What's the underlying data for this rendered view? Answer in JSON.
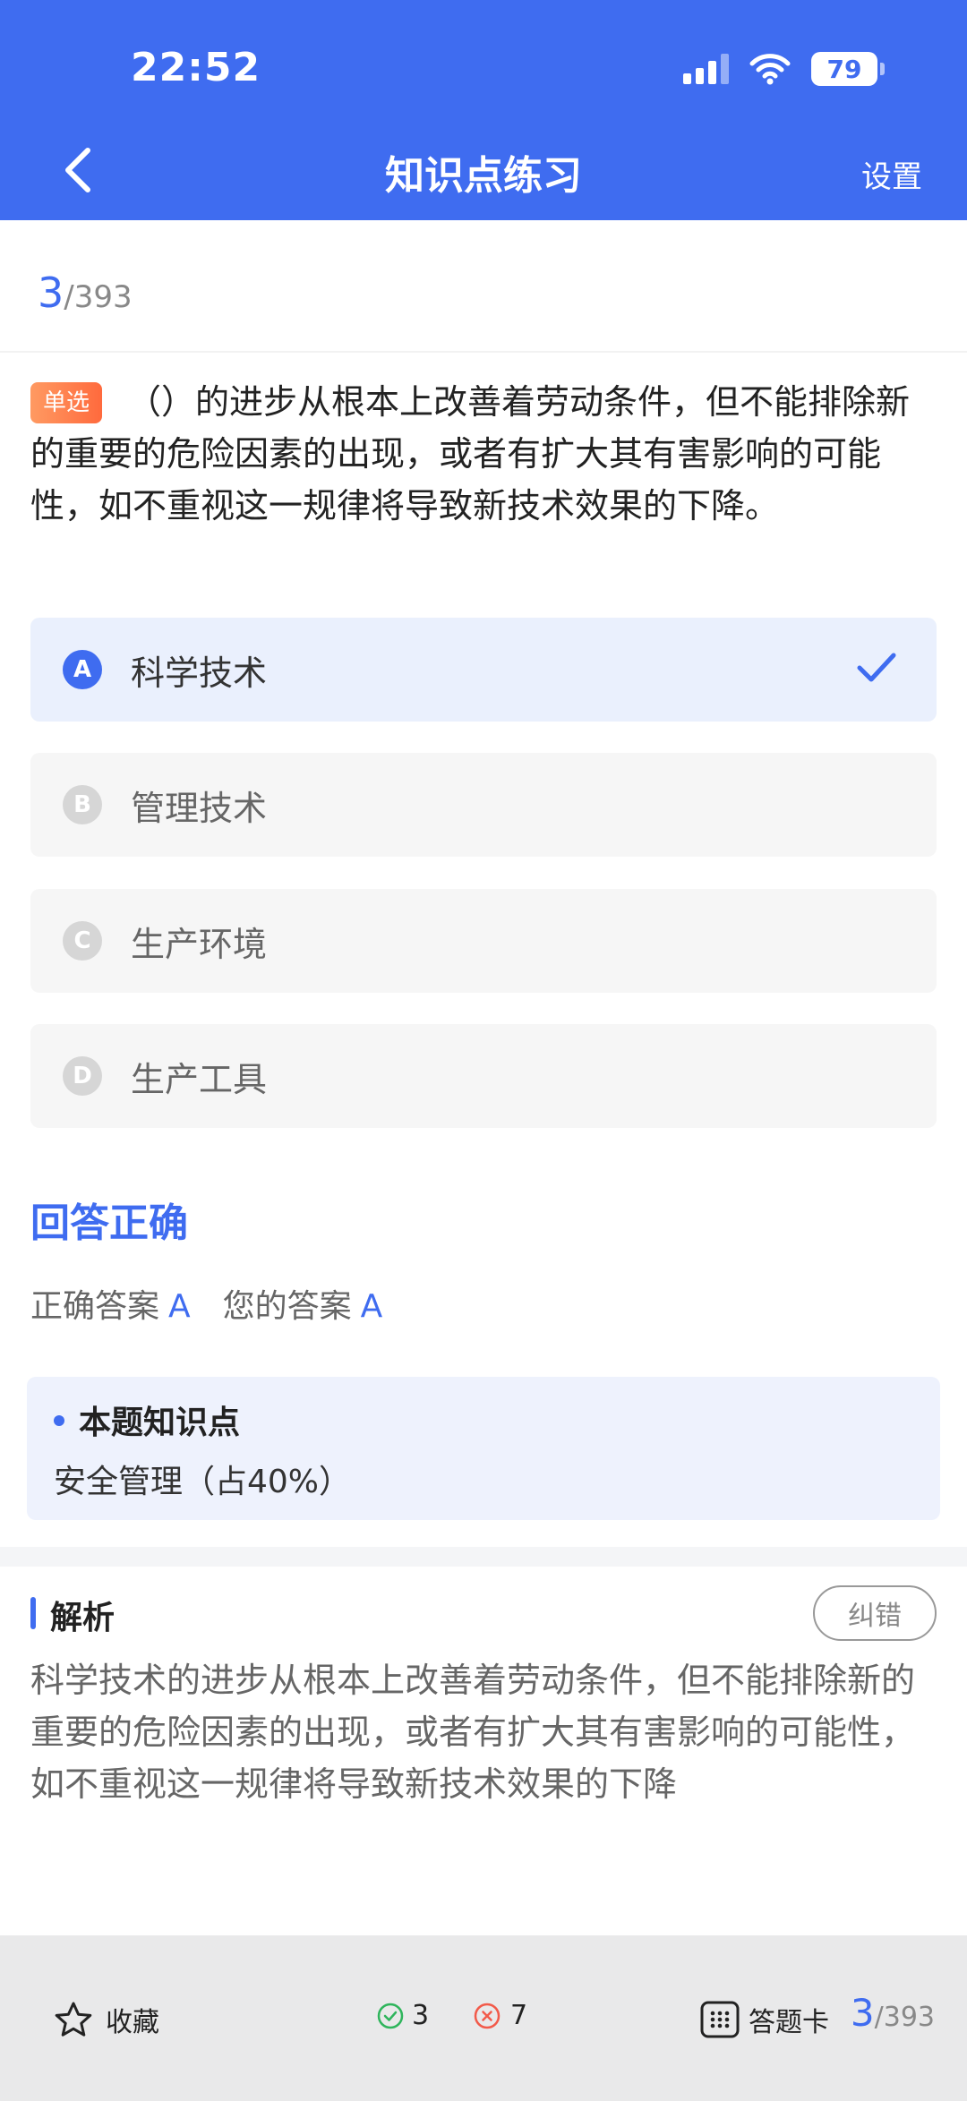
{
  "status_bar": {
    "time": "22:52",
    "battery": "79"
  },
  "nav": {
    "title": "知识点练习",
    "settings_label": "设置"
  },
  "progress": {
    "current": "3",
    "total": "/393"
  },
  "question": {
    "type_tag": "单选",
    "text": "（）的进步从根本上改善着劳动条件，但不能排除新的重要的危险因素的出现，或者有扩大其有害影响的可能性，如不重视这一规律将导致新技术效果的下降。"
  },
  "options": [
    {
      "letter": "A",
      "text": "科学技术",
      "selected": true
    },
    {
      "letter": "B",
      "text": "管理技术",
      "selected": false
    },
    {
      "letter": "C",
      "text": "生产环境",
      "selected": false
    },
    {
      "letter": "D",
      "text": "生产工具",
      "selected": false
    }
  ],
  "result": {
    "title": "回答正确",
    "correct_label": "正确答案",
    "correct_answer": "A",
    "your_label": "您的答案",
    "your_answer": "A"
  },
  "knowledge": {
    "title": "本题知识点",
    "value": "安全管理（占40%）"
  },
  "analysis": {
    "title": "解析",
    "correct_button": "纠错",
    "text": "科学技术的进步从根本上改善着劳动条件，但不能排除新的重要的危险因素的出现，或者有扩大其有害影响的可能性，如不重视这一规律将导致新技术效果的下降"
  },
  "bottom_bar": {
    "favorite_label": "收藏",
    "right_count": "3",
    "wrong_count": "7",
    "card_label": "答题卡",
    "current": "3",
    "total": "/393"
  },
  "colors": {
    "primary": "#3f6cf0",
    "tag_orange": "#ff6a3d",
    "right_green": "#2fb55c",
    "wrong_red": "#f25a4a"
  },
  "icons": [
    "back-arrow-icon",
    "wifi-icon",
    "signal-icon",
    "battery-icon",
    "checkmark-icon",
    "star-icon",
    "check-circle-icon",
    "x-circle-icon",
    "grid-card-icon"
  ]
}
